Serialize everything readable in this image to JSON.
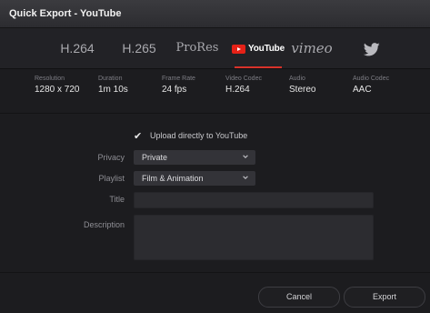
{
  "window": {
    "title": "Quick Export - YouTube"
  },
  "tabs": {
    "h264": "H.264",
    "h265": "H.265",
    "prores": "ProRes",
    "youtube": "YouTube",
    "vimeo": "vimeo",
    "twitter_icon": "twitter-icon",
    "active": "youtube",
    "active_color": "#d8322a"
  },
  "specs": [
    {
      "label": "Resolution",
      "value": "1280 x 720"
    },
    {
      "label": "Duration",
      "value": "1m 10s"
    },
    {
      "label": "Frame Rate",
      "value": "24 fps"
    },
    {
      "label": "Video Codec",
      "value": "H.264"
    },
    {
      "label": "Audio",
      "value": "Stereo"
    },
    {
      "label": "Audio Codec",
      "value": "AAC"
    }
  ],
  "upload": {
    "label": "Upload directly to YouTube",
    "checked": true
  },
  "form": {
    "privacy": {
      "label": "Privacy",
      "value": "Private"
    },
    "playlist": {
      "label": "Playlist",
      "value": "Film & Animation"
    },
    "title": {
      "label": "Title",
      "value": ""
    },
    "description": {
      "label": "Description",
      "value": ""
    }
  },
  "buttons": {
    "cancel": "Cancel",
    "export": "Export"
  }
}
